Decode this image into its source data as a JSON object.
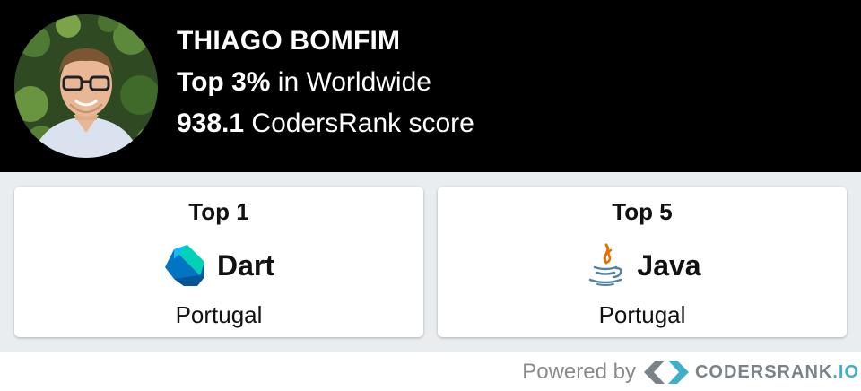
{
  "profile": {
    "name": "THIAGO BOMFIM",
    "rank_top": "Top 3%",
    "rank_region": " in Worldwide",
    "score": "938.1",
    "score_label": " CodersRank score"
  },
  "cards": [
    {
      "rank": "Top 1",
      "language": "Dart",
      "icon": "dart-logo-icon",
      "country": "Portugal"
    },
    {
      "rank": "Top 5",
      "language": "Java",
      "icon": "java-logo-icon",
      "country": "Portugal"
    }
  ],
  "footer": {
    "powered_by": "Powered by",
    "brand_main": "CODERSRANK",
    "brand_suffix": ".IO",
    "icon": "codersrank-logo-icon"
  },
  "colors": {
    "header_bg": "#000000",
    "cards_bg": "#e9edf0",
    "dart": "#00c4b3",
    "java_red": "#e76f00",
    "java_blue": "#5382a1",
    "brand_accent": "#3fb0c6"
  }
}
